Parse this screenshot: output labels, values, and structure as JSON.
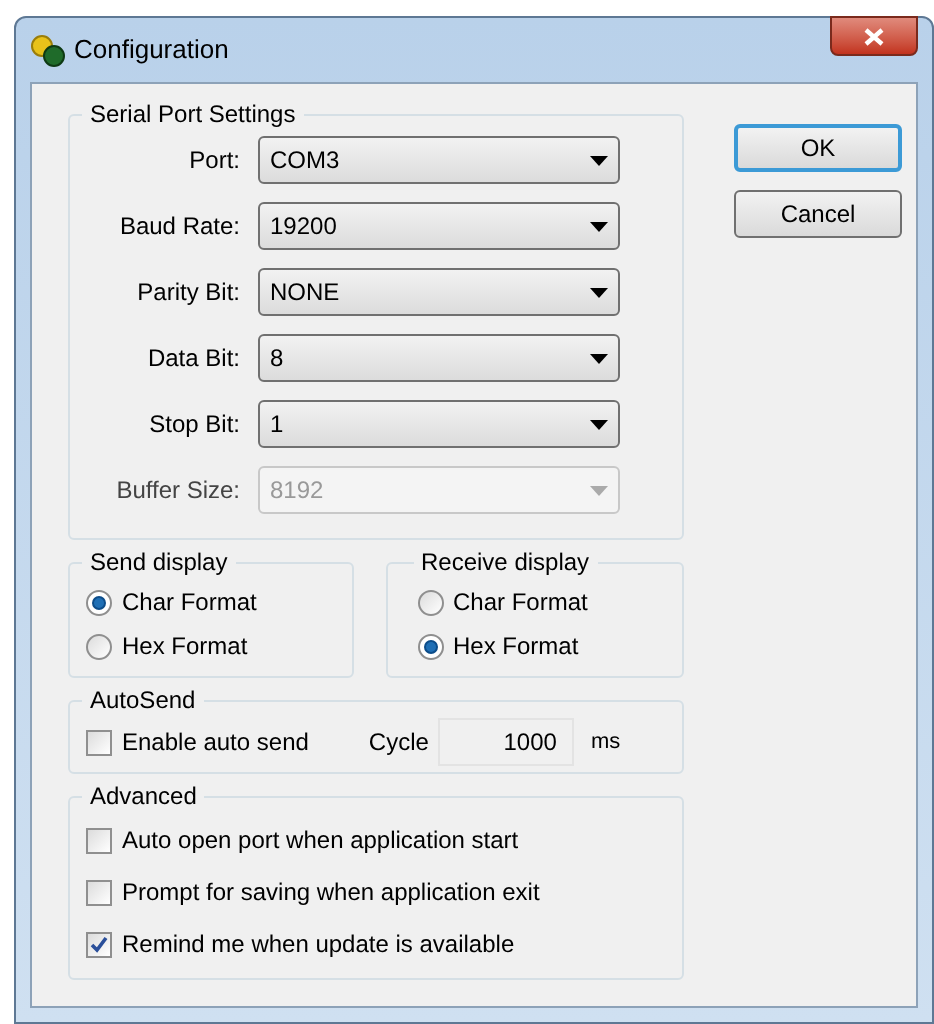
{
  "window": {
    "title": "Configuration"
  },
  "serial_port_settings": {
    "title": "Serial Port Settings",
    "fields": [
      {
        "label": "Port:",
        "value": "COM3",
        "disabled": false
      },
      {
        "label": "Baud Rate:",
        "value": "19200",
        "disabled": false
      },
      {
        "label": "Parity Bit:",
        "value": "NONE",
        "disabled": false
      },
      {
        "label": "Data Bit:",
        "value": "8",
        "disabled": false
      },
      {
        "label": "Stop Bit:",
        "value": "1",
        "disabled": false
      },
      {
        "label": "Buffer Size:",
        "value": "8192",
        "disabled": true
      }
    ]
  },
  "buttons": [
    {
      "label": "OK",
      "default": true
    },
    {
      "label": "Cancel",
      "default": false
    }
  ],
  "send_display": {
    "title": "Send display",
    "options": [
      {
        "label": "Char Format",
        "selected": true
      },
      {
        "label": "Hex  Format",
        "selected": false
      }
    ]
  },
  "receive_display": {
    "title": "Receive display",
    "options": [
      {
        "label": "Char Format",
        "selected": false
      },
      {
        "label": "Hex  Format",
        "selected": true
      }
    ]
  },
  "autosend": {
    "title": "AutoSend",
    "enable": {
      "label": "Enable auto send",
      "checked": false
    },
    "cycle_label": "Cycle",
    "cycle_value": "1000",
    "unit": "ms"
  },
  "advanced": {
    "title": "Advanced",
    "options": [
      {
        "label": "Auto open port when application start",
        "checked": false
      },
      {
        "label": "Prompt for saving when application exit",
        "checked": false
      },
      {
        "label": "Remind me when update is available",
        "checked": true
      }
    ]
  }
}
